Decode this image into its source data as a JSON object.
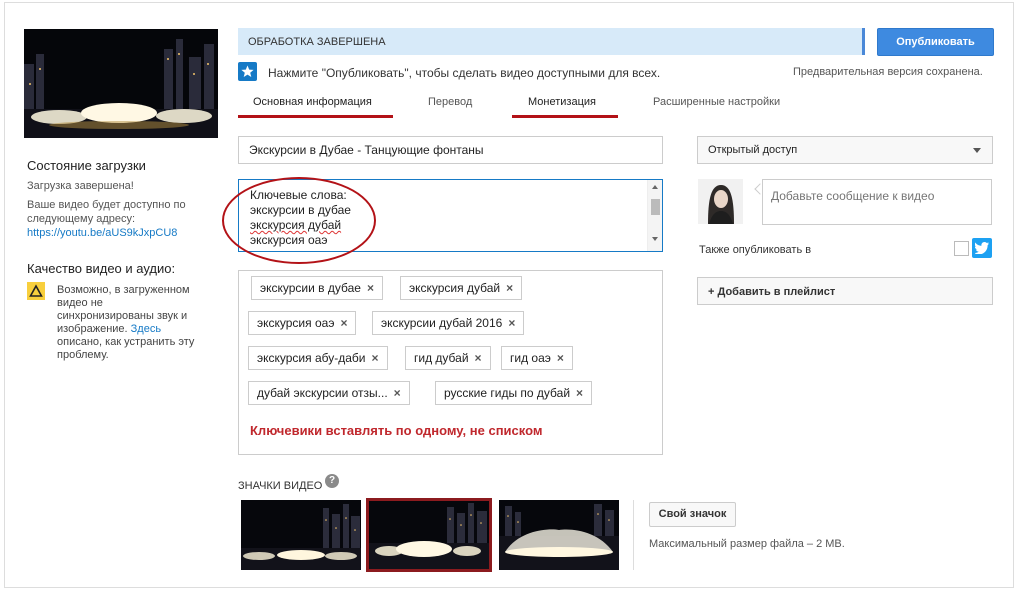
{
  "left": {
    "upload_status_heading": "Состояние загрузки",
    "upload_status_text": "Загрузка завершена!",
    "video_address_line1": "Ваше видео будет доступно по",
    "video_address_line2": "следующему адресу:",
    "video_url": "https://youtu.be/aUS9kJxpCU8",
    "quality_heading": "Качество видео и аудио:",
    "warning_lines": [
      "Возможно, в загруженном",
      "видео не",
      "синхронизированы звук и",
      "изображение."
    ],
    "warning_link": "Здесь",
    "warning_tail_lines": [
      "описано, как устранить эту",
      "проблему."
    ]
  },
  "status": {
    "processing_text": "ОБРАБОТКА ЗАВЕРШЕНА",
    "publish_label": "Опубликовать",
    "hint": "Нажмите \"Опубликовать\", чтобы сделать видео доступными для всех.",
    "saved": "Предварительная версия сохранена."
  },
  "tabs": [
    {
      "label": "Основная информация",
      "active": true
    },
    {
      "label": "Перевод",
      "active": false
    },
    {
      "label": "Монетизация",
      "active": false
    },
    {
      "label": "Расширенные настройки",
      "active": false
    }
  ],
  "form": {
    "title_value": "Экскурсии в Дубае - Танцующие фонтаны",
    "description_lines": [
      "Ключевые слова:",
      "экскурсии в дубае",
      "экскурсия дубай",
      "экскурсия оаэ"
    ],
    "tags": [
      "экскурсии в дубае",
      "экскурсия дубай",
      "экскурсия оаэ",
      "экскурсии дубай 2016",
      "экскурсия абу-даби",
      "гид дубай",
      "гид оаэ",
      "дубай экскурсии отзы...",
      "русские гиды по дубай"
    ],
    "tag_remove_symbol": "×",
    "annotation": "Ключевики вставлять по одному, не списком"
  },
  "right": {
    "privacy_value": "Открытый доступ",
    "message_placeholder": "Добавьте сообщение к видео",
    "also_publish_label": "Также опубликовать в",
    "add_playlist_label": "+ Добавить в плейлист"
  },
  "thumbnails": {
    "label": "ЗНАЧКИ ВИДЕО",
    "help_symbol": "?",
    "custom_button": "Свой значок",
    "max_size": "Максимальный размер файла – 2 MB.",
    "selected_index": 1
  },
  "colors": {
    "accent_blue": "#167ac6",
    "publish_blue": "#3e8ae0",
    "annotation_red": "#c0282d",
    "status_bar_bg": "#d7eaf9"
  }
}
